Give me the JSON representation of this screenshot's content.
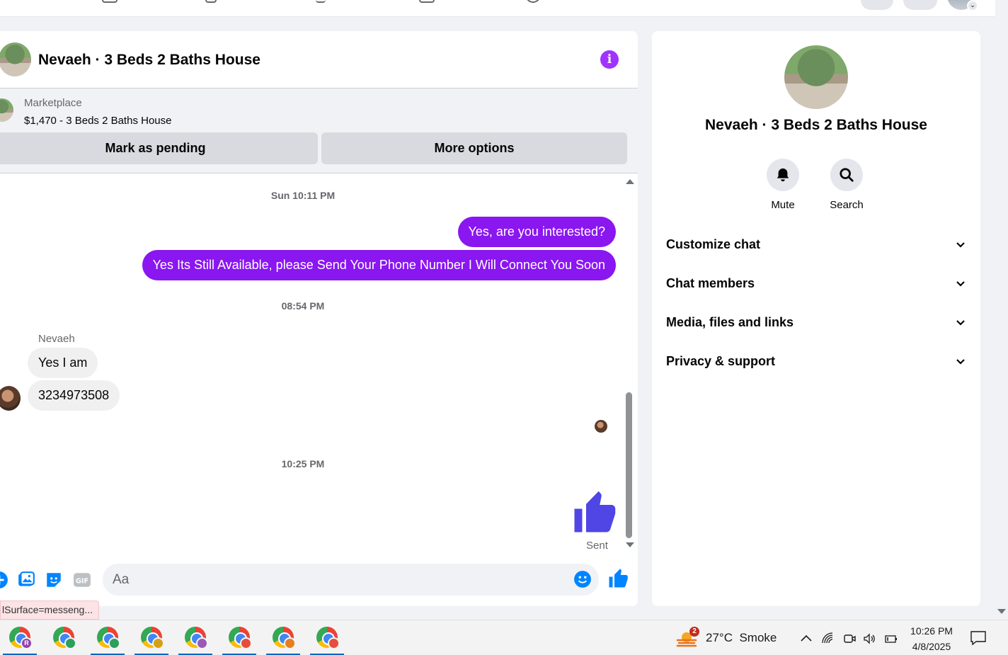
{
  "chat": {
    "title": "Nevaeh · 3 Beds 2 Baths House",
    "marketplace": {
      "label": "Marketplace",
      "listing": "$1,470 - 3 Beds 2 Baths House",
      "mark_pending": "Mark as pending",
      "more_options": "More options"
    },
    "messages": {
      "ts1": "Sun 10:11 PM",
      "out1": "Yes, are you interested?",
      "out2": "Yes Its Still Available, please Send Your Phone Number I Will Connect You Soon",
      "ts2": "08:54 PM",
      "sender": "Nevaeh",
      "in1": "Yes I am",
      "in2": "3234973508",
      "ts3": "10:25 PM",
      "status": "Sent"
    },
    "composer": {
      "placeholder": "Aa"
    },
    "status_bar_url": "lSurface=messeng..."
  },
  "info_panel": {
    "name": "Nevaeh · 3 Beds 2 Baths House",
    "actions": [
      {
        "label": "Mute",
        "icon": "bell-icon"
      },
      {
        "label": "Search",
        "icon": "search-icon"
      }
    ],
    "sections": [
      {
        "label": "Customize chat"
      },
      {
        "label": "Chat members"
      },
      {
        "label": "Media, files and links"
      },
      {
        "label": "Privacy & support"
      }
    ]
  },
  "taskbar": {
    "weather": {
      "temp": "27°C",
      "condition": "Smoke",
      "alerts": "2"
    },
    "time": "10:26 PM",
    "date": "4/8/2025",
    "apps": [
      {
        "badge": "R",
        "badge_color": "#8e44ad"
      },
      {
        "badge": "",
        "badge_color": "#2e9e5b"
      },
      {
        "badge": "",
        "badge_color": "#2e9e5b"
      },
      {
        "badge": "",
        "badge_color": "#d4a017"
      },
      {
        "badge": "",
        "badge_color": "#9b59b6"
      },
      {
        "badge": "",
        "badge_color": "#e74c3c"
      },
      {
        "badge": "",
        "badge_color": "#e67e22"
      },
      {
        "badge": "",
        "badge_color": "#e74c3c"
      }
    ]
  },
  "colors": {
    "accent": "#8a16f0",
    "like_blue": "#4f46e5",
    "info_purple": "#a033ff"
  }
}
